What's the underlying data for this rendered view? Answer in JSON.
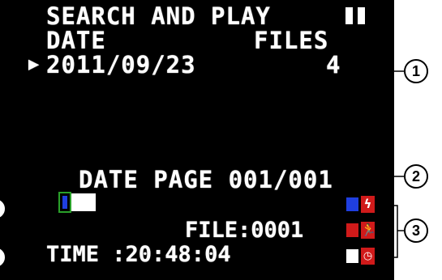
{
  "screen": {
    "title": "SEARCH AND PLAY",
    "col_date": "DATE",
    "col_files": "FILES",
    "selector": "▶",
    "entry_date": "2011/09/23",
    "entry_files": "4",
    "page_label": "DATE PAGE 001/001",
    "file_label": "FILE:0001",
    "time_label": "TIME :20:48:04"
  },
  "indicators": {
    "colors": {
      "blue": "#1f3fe0",
      "red": "#d01a1a",
      "white": "#ffffff"
    },
    "icons": [
      "lightning-icon",
      "running-person-icon",
      "clock-icon"
    ]
  },
  "callouts": [
    "1",
    "2",
    "3"
  ]
}
